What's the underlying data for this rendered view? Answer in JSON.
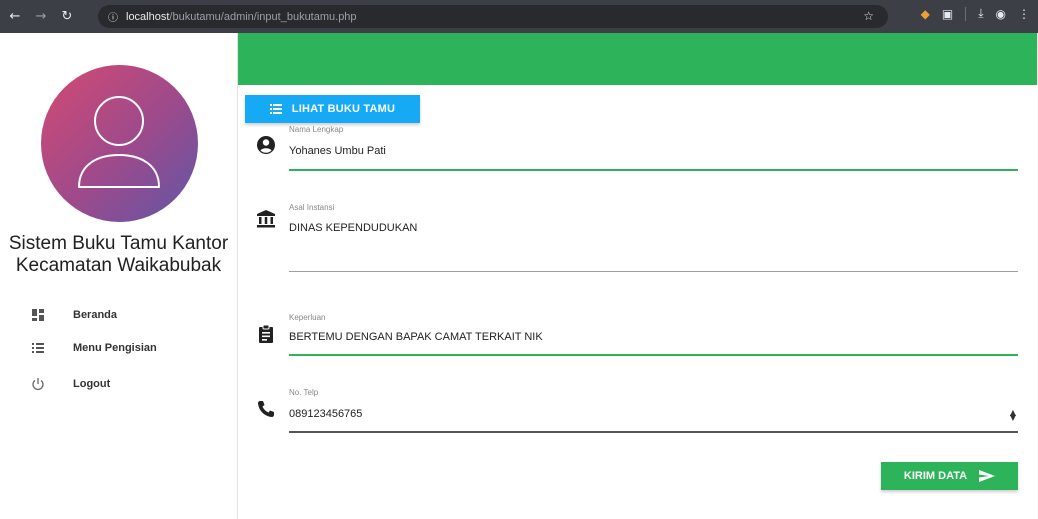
{
  "browser": {
    "url_host": "localhost",
    "url_path": "/bukutamu/admin/input_bukutamu.php"
  },
  "sidebar": {
    "title_line1": "Sistem Buku Tamu Kantor",
    "title_line2": "Kecamatan Waikabubak",
    "items": [
      {
        "label": "Beranda",
        "icon": "dashboard-icon"
      },
      {
        "label": "Menu Pengisian",
        "icon": "list-icon"
      },
      {
        "label": "Logout",
        "icon": "power-icon"
      }
    ]
  },
  "main": {
    "view_button_label": "LIHAT BUKU TAMU",
    "fields": [
      {
        "label": "Nama Lengkap",
        "value": "Yohanes Umbu Pati",
        "icon": "account-icon"
      },
      {
        "label": "Asal Instansi",
        "value": "DINAS KEPENDUDUKAN",
        "icon": "bank-icon"
      },
      {
        "label": "Keperluan",
        "value": "BERTEMU DENGAN BAPAK CAMAT TERKAIT NIK",
        "icon": "clipboard-icon"
      },
      {
        "label": "No. Telp",
        "value": "089123456765",
        "icon": "phone-icon"
      }
    ],
    "submit_label": "KIRIM DATA"
  },
  "colors": {
    "accent_green": "#2db35a",
    "accent_blue": "#16aaf4"
  }
}
